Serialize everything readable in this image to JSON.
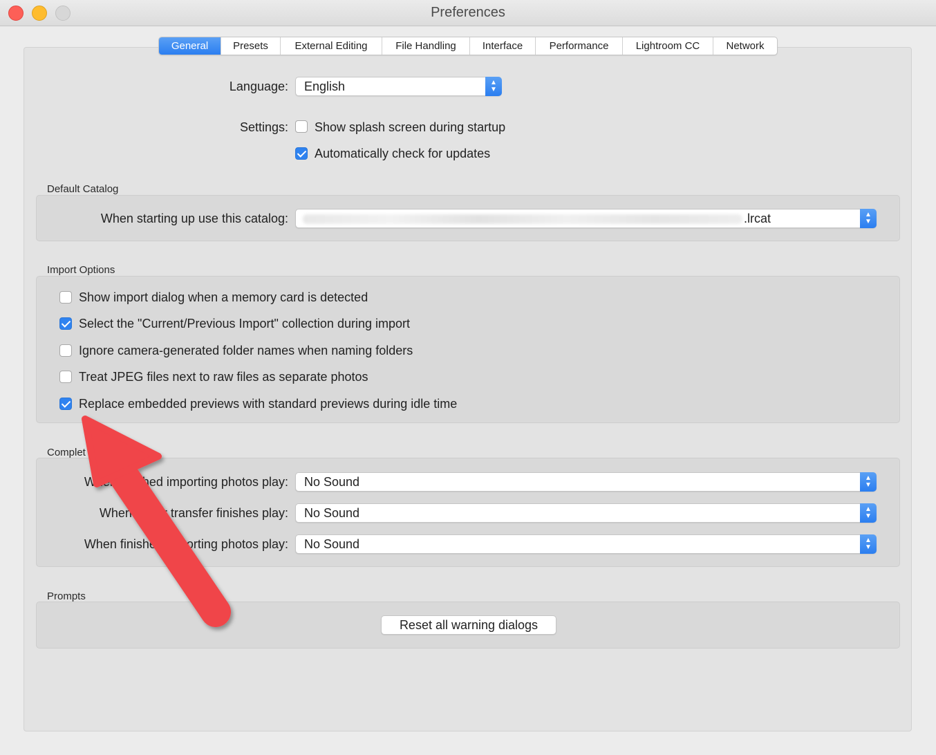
{
  "window": {
    "title": "Preferences"
  },
  "tabs": [
    {
      "label": "General",
      "active": true
    },
    {
      "label": "Presets",
      "active": false
    },
    {
      "label": "External Editing",
      "active": false
    },
    {
      "label": "File Handling",
      "active": false
    },
    {
      "label": "Interface",
      "active": false
    },
    {
      "label": "Performance",
      "active": false
    },
    {
      "label": "Lightroom CC",
      "active": false
    },
    {
      "label": "Network",
      "active": false
    }
  ],
  "language": {
    "label": "Language:",
    "value": "English"
  },
  "settings": {
    "label": "Settings:",
    "options": [
      {
        "label": "Show splash screen during startup",
        "checked": false
      },
      {
        "label": "Automatically check for updates",
        "checked": true
      }
    ]
  },
  "default_catalog": {
    "title": "Default Catalog",
    "label": "When starting up use this catalog:",
    "value_suffix": ".lrcat"
  },
  "import_options": {
    "title": "Import Options",
    "options": [
      {
        "label": "Show import dialog when a memory card is detected",
        "checked": false
      },
      {
        "label": "Select the \"Current/Previous Import\" collection during import",
        "checked": true
      },
      {
        "label": "Ignore camera-generated folder names when naming folders",
        "checked": false
      },
      {
        "label": "Treat JPEG files next to raw files as separate photos",
        "checked": false
      },
      {
        "label": "Replace embedded previews with standard previews during idle time",
        "checked": true
      }
    ]
  },
  "completion_sounds": {
    "title": "Complet",
    "rows": [
      {
        "label": "When finished importing photos play:",
        "value": "No Sound"
      },
      {
        "label": "When tether transfer finishes play:",
        "value": "No Sound"
      },
      {
        "label": "When finished exporting photos play:",
        "value": "No Sound"
      }
    ]
  },
  "prompts": {
    "title": "Prompts",
    "reset_label": "Reset all warning dialogs"
  },
  "colors": {
    "accent": "#2f83f0",
    "annotation_arrow": "#f0444a"
  }
}
